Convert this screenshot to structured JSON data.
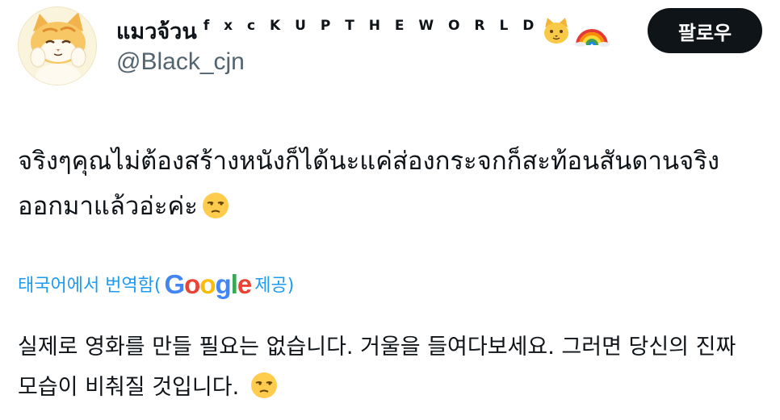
{
  "user": {
    "display_name": "แมวจ้วน",
    "name_suffix": "f x c K  U P  T H E  W O R L D",
    "badge_icons": [
      "cat-face-icon",
      "rainbow-icon"
    ],
    "handle": "@Black_cjn",
    "avatar_icon": "cat-avatar-icon"
  },
  "follow_button": {
    "label": "팔로우"
  },
  "tweet": {
    "text": "จริงๆคุณไม่ต้องสร้างหนังก็ได้นะแค่ส่องกระจกก็สะท้อนสันดานจริงออกมาแล้วอ่ะค่ะ",
    "trailing_emoji": "unamused-face-icon"
  },
  "translation": {
    "prefix": "태국어에서 번역함(",
    "provider_letters": [
      "G",
      "o",
      "o",
      "g",
      "l",
      "e"
    ],
    "suffix": " 제공)",
    "text": "실제로 영화를 만들 필요는 없습니다. 거울을 들여다보세요. 그러면 당신의 진짜 모습이 비춰질 것입니다.",
    "trailing_emoji": "unamused-face-icon"
  },
  "colors": {
    "accent": "#1d9bf0",
    "text_primary": "#0f1419",
    "text_secondary": "#536471",
    "button_bg": "#0f1419"
  }
}
